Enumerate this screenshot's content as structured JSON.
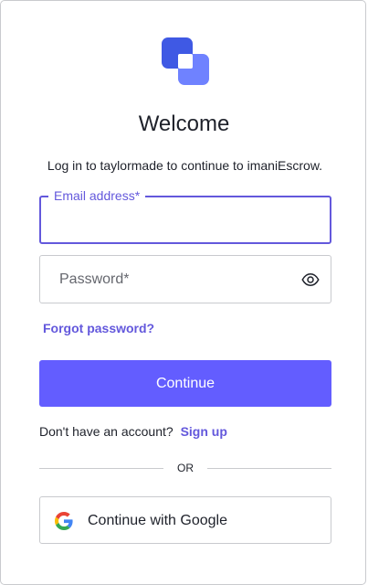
{
  "brand": {
    "logo_icon": "overlapping-squares-logo-icon",
    "accent_color": "#635dff",
    "logo_dark": "#3f59e4",
    "logo_light": "#6f82ff"
  },
  "header": {
    "title": "Welcome",
    "subtitle": "Log in to taylormade to continue to imaniEscrow."
  },
  "form": {
    "email_label": "Email address*",
    "email_value": "",
    "password_placeholder": "Password*",
    "password_value": "",
    "password_toggle_icon": "eye-icon",
    "forgot_password": "Forgot password?",
    "continue_label": "Continue"
  },
  "signup": {
    "prompt": "Don't have an account?",
    "link": "Sign up"
  },
  "divider": {
    "label": "OR"
  },
  "social": {
    "google_label": "Continue with Google",
    "google_icon": "google-g-icon"
  }
}
